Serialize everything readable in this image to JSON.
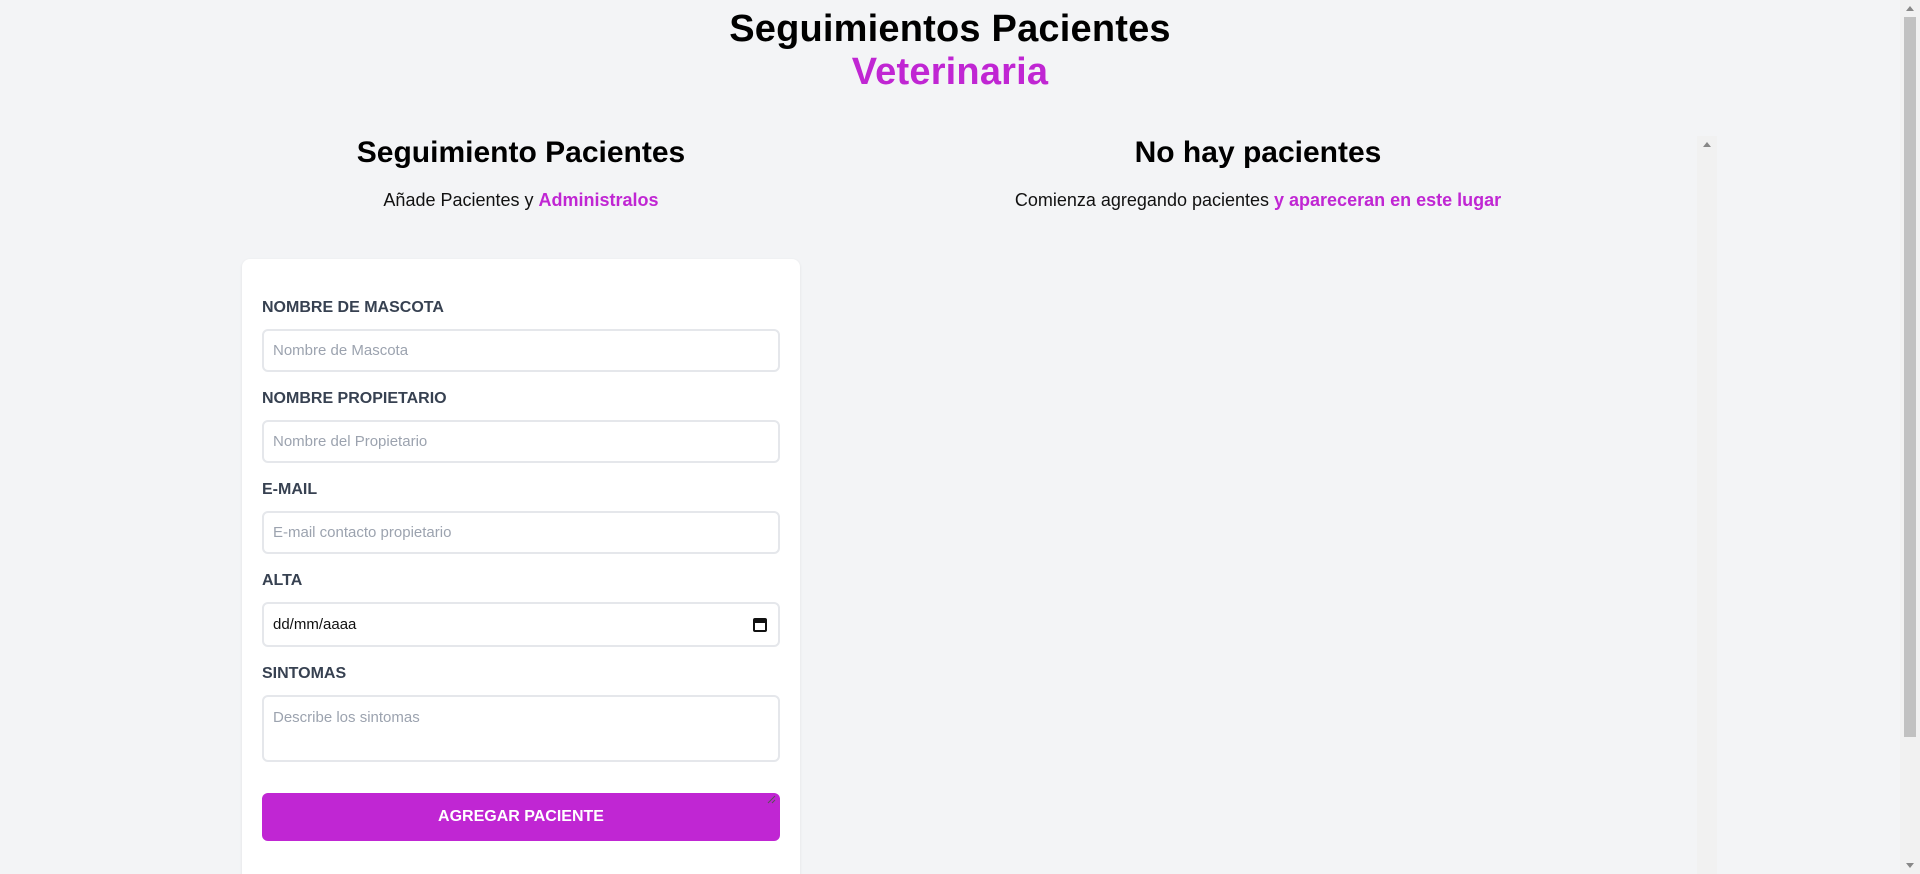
{
  "colors": {
    "accent": "#c026d3",
    "background": "#f3f4f6",
    "card": "#ffffff"
  },
  "header": {
    "title": "Seguimientos Pacientes",
    "accent_title": "Veterinaria"
  },
  "form_section": {
    "heading": "Seguimiento Pacientes",
    "subtitle_plain": "Añade Pacientes y ",
    "subtitle_accent": "Administralos",
    "fields": {
      "pet_name": {
        "label": "Nombre de Mascota",
        "placeholder": "Nombre de Mascota",
        "value": ""
      },
      "owner_name": {
        "label": "Nombre Propietario",
        "placeholder": "Nombre del Propietario",
        "value": ""
      },
      "email": {
        "label": "E-mail",
        "placeholder": "E-mail contacto propietario",
        "value": ""
      },
      "discharge": {
        "label": "Alta",
        "value": "dd/mm/aaaa",
        "icon": "calendar-icon"
      },
      "symptoms": {
        "label": "Sintomas",
        "placeholder": "Describe los sintomas",
        "value": ""
      }
    },
    "submit_label": "Agregar Paciente"
  },
  "list_section": {
    "heading": "No hay pacientes",
    "subtitle_plain": "Comienza agregando pacientes ",
    "subtitle_accent": "y apareceran en este lugar"
  }
}
